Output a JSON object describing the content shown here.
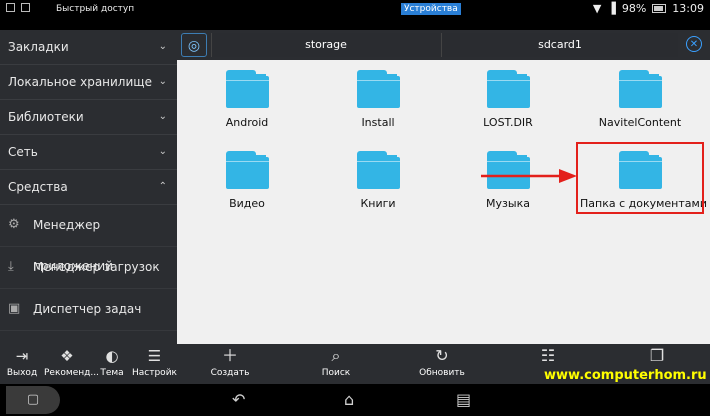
{
  "statusbar": {
    "quick_access": "Быстрый доступ",
    "devices": "Устройства",
    "battery": "98%",
    "time": "13:09"
  },
  "sidebar": {
    "items": [
      {
        "label": "Закладки",
        "chevron": "chevron-down-icon"
      },
      {
        "label": "Локальное хранилище",
        "chevron": "chevron-down-icon"
      },
      {
        "label": "Библиотеки",
        "chevron": "chevron-down-icon"
      },
      {
        "label": "Сеть",
        "chevron": "chevron-down-icon"
      },
      {
        "label": "Средства",
        "chevron": "chevron-up-icon"
      }
    ],
    "sub": [
      {
        "label": "Менеджер приложений",
        "icon": "gears-icon"
      },
      {
        "label": "Менеджер загрузок",
        "icon": "download-icon"
      },
      {
        "label": "Диспетчер задач",
        "icon": "task-manager-icon"
      }
    ]
  },
  "toolbar": {
    "crumbs": [
      "storage",
      "sdcard1"
    ]
  },
  "folders": [
    {
      "name": "Android"
    },
    {
      "name": "Install"
    },
    {
      "name": "LOST.DIR"
    },
    {
      "name": "NavitelContent"
    },
    {
      "name": "Видео"
    },
    {
      "name": "Книги"
    },
    {
      "name": "Музыка"
    },
    {
      "name": "Папка с документами"
    }
  ],
  "bottom": {
    "side_buttons": [
      "Выход",
      "Рекоменд...",
      "Тема",
      "Настройки"
    ],
    "main_buttons": [
      "Создать",
      "Поиск",
      "Обновить",
      ""
    ]
  },
  "watermark": "www.computerhom.ru",
  "colors": {
    "folder": "#33b5e5",
    "highlight": "#e3201b",
    "accent": "#2a7fd6"
  }
}
